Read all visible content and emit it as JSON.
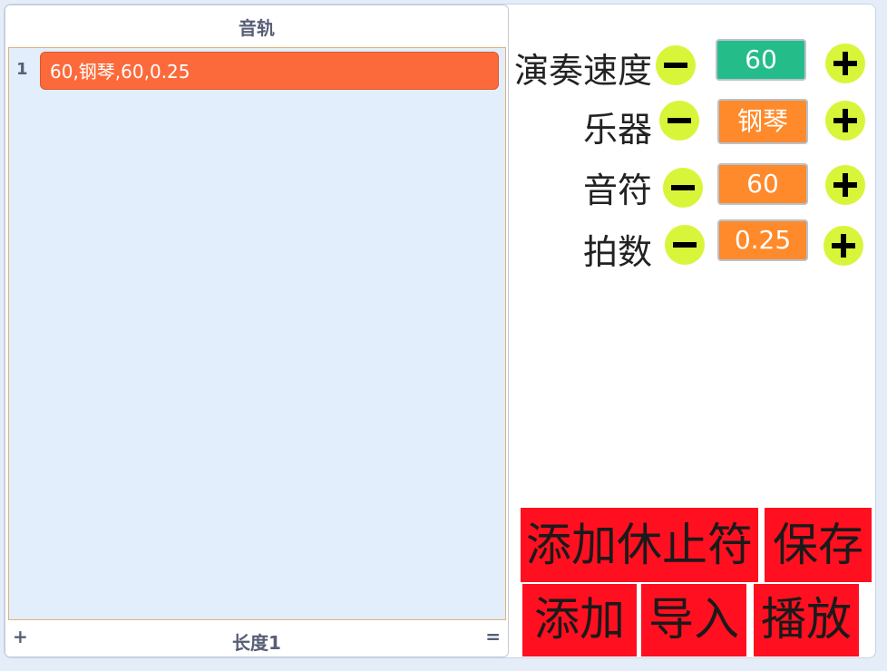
{
  "list": {
    "title": "音轨",
    "rows": [
      {
        "index": "1",
        "value": "60,钢琴,60,0.25"
      }
    ],
    "footer_add": "+",
    "footer_length": "长度1",
    "footer_resize": "="
  },
  "controls": {
    "tempo": {
      "label": "演奏速度",
      "value": "60"
    },
    "instrument": {
      "label": "乐器",
      "value": "钢琴"
    },
    "note": {
      "label": "音符",
      "value": "60"
    },
    "beats": {
      "label": "拍数",
      "value": "0.25"
    }
  },
  "buttons": {
    "add_rest": "添加休止符",
    "save": "保存",
    "add": "添加",
    "import": "导入",
    "play": "播放"
  },
  "colors": {
    "tempo_value": "#24bd8a",
    "orange_value": "#ff8a2b",
    "round_button": "#d9f53a",
    "action_button": "#ff0f1f",
    "list_item": "#fc6a3b"
  },
  "icons": {
    "minus": "minus-icon",
    "plus": "plus-icon"
  }
}
